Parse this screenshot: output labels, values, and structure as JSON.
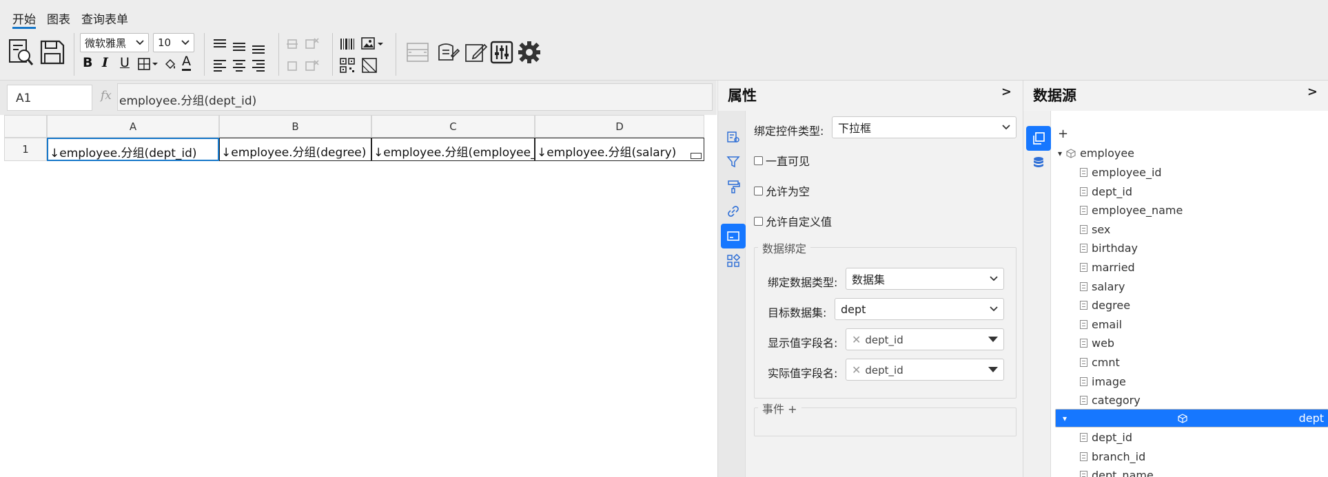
{
  "tabs": [
    {
      "label": "开始",
      "active": true
    },
    {
      "label": "图表",
      "active": false
    },
    {
      "label": "查询表单",
      "active": false
    }
  ],
  "toolbar": {
    "font_family": "微软雅黑",
    "font_size": "10",
    "bold": "B",
    "italic": "I",
    "underline": "U",
    "font_color": "A",
    "icons": [
      "preview-icon",
      "save-icon",
      "border-icon",
      "fill-color-icon",
      "align-icons",
      "merge-icons",
      "barcode-icon",
      "image-icon",
      "qrcode-icon",
      "diagonal-icon",
      "chart-icons",
      "settings-icon"
    ]
  },
  "formula_bar": {
    "cell_ref": "A1",
    "fx": "fx",
    "formula": "employee.分组(dept_id)"
  },
  "grid": {
    "columns": [
      "A",
      "B",
      "C",
      "D"
    ],
    "rows": [
      {
        "num": "1",
        "cells": [
          "↓employee.分组(dept_id)",
          "↓employee.分组(degree)",
          "↓employee.分组(employee_id)",
          "↓employee.分组(salary)"
        ]
      }
    ]
  },
  "properties": {
    "title": "属性",
    "collapse": ">",
    "control_type_label": "绑定控件类型:",
    "control_type_value": "下拉框",
    "always_visible": "一直可见",
    "allow_empty": "允许为空",
    "allow_custom": "允许自定义值",
    "data_binding": {
      "legend": "数据绑定",
      "data_type_label": "绑定数据类型:",
      "data_type_value": "数据集",
      "target_dataset_label": "目标数据集:",
      "target_dataset_value": "dept",
      "display_field_label": "显示值字段名:",
      "display_field_value": "dept_id",
      "actual_field_label": "实际值字段名:",
      "actual_field_value": "dept_id"
    },
    "events_legend": "事件 +",
    "accent_color": "#1677ff"
  },
  "datasource": {
    "title": "数据源",
    "collapse": ">",
    "add": "+",
    "datasets": [
      {
        "name": "employee",
        "expanded": true,
        "fields": [
          "employee_id",
          "dept_id",
          "employee_name",
          "sex",
          "birthday",
          "married",
          "salary",
          "degree",
          "email",
          "web",
          "cmnt",
          "image",
          "category"
        ]
      },
      {
        "name": "dept",
        "expanded": true,
        "selected": true,
        "fields": [
          "dept_id",
          "branch_id",
          "dept_name"
        ]
      }
    ]
  }
}
